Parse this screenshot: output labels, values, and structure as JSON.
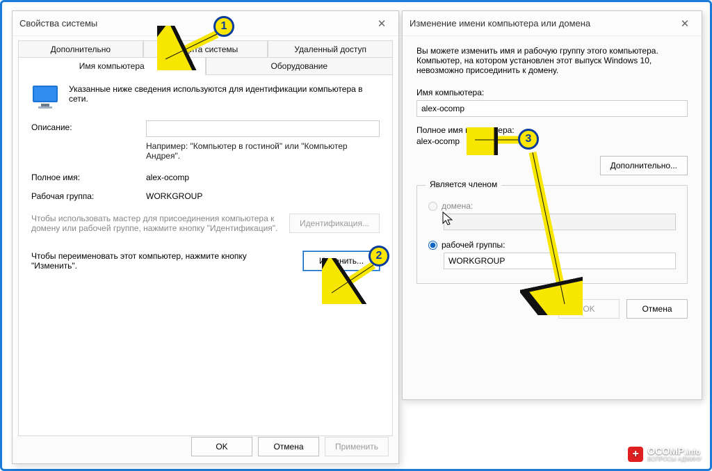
{
  "dlg1": {
    "title": "Свойства системы",
    "tabs_row1": [
      "Дополнительно",
      "Защита системы",
      "Удаленный доступ"
    ],
    "tabs_row2": [
      "Имя компьютера",
      "Оборудование"
    ],
    "active_tab": "Имя компьютера",
    "intro": "Указанные ниже сведения используются для идентификации компьютера в сети.",
    "description_label": "Описание:",
    "description_value": "",
    "example": "Например: \"Компьютер в гостиной\" или \"Компьютер Андрея\".",
    "fullname_label": "Полное имя:",
    "fullname_value": "alex-ocomp",
    "workgroup_label": "Рабочая группа:",
    "workgroup_value": "WORKGROUP",
    "wizard_text": "Чтобы использовать мастер для присоединения компьютера к домену или рабочей группе, нажмите кнопку \"Идентификация\".",
    "identify_btn": "Идентификация...",
    "rename_text": "Чтобы переименовать этот компьютер, нажмите кнопку \"Изменить\".",
    "change_btn": "Изменить...",
    "ok": "OK",
    "cancel": "Отмена",
    "apply": "Применить"
  },
  "dlg2": {
    "title": "Изменение имени компьютера или домена",
    "intro": "Вы можете изменить имя и рабочую группу этого компьютера. Компьютер, на котором установлен этот выпуск Windows 10, невозможно присоединить к домену.",
    "name_label": "Имя компьютера:",
    "name_value": "alex-ocomp",
    "fullname_label": "Полное имя компьютера:",
    "fullname_value": "alex-ocomp",
    "more_btn": "Дополнительно...",
    "member_of": "Является членом",
    "domain_label": "домена:",
    "domain_value": "",
    "workgroup_radio_label": "рабочей группы:",
    "workgroup_value": "WORKGROUP",
    "ok": "OK",
    "cancel": "Отмена"
  },
  "callouts": {
    "c1": "1",
    "c2": "2",
    "c3": "3"
  },
  "watermark": {
    "brand": "OCOMP",
    "tld": ".info",
    "sub": "ВОПРОСЫ АДМИНУ"
  }
}
